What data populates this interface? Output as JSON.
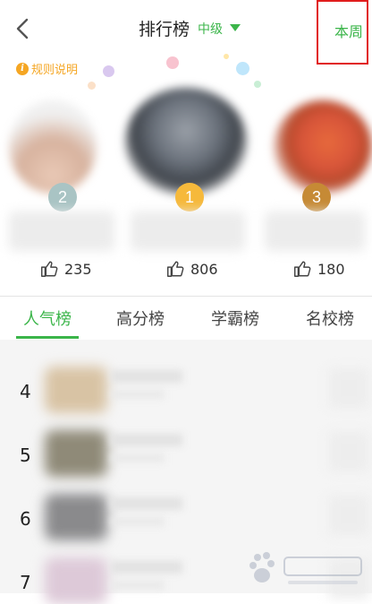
{
  "header": {
    "title": "排行榜",
    "level_label": "中级",
    "week_label": "本周",
    "back_icon": "chevron-left-icon"
  },
  "rules": {
    "icon": "info-icon",
    "icon_glyph": "i",
    "label": "规则说明"
  },
  "podium": [
    {
      "rank": "2",
      "likes": "235",
      "badge_color": "#a9c4c4"
    },
    {
      "rank": "1",
      "likes": "806",
      "badge_color": "#f6b93b"
    },
    {
      "rank": "3",
      "likes": "180",
      "badge_color": "#c68a35"
    }
  ],
  "tabs": [
    {
      "label": "人气榜",
      "active": true
    },
    {
      "label": "高分榜",
      "active": false
    },
    {
      "label": "学霸榜",
      "active": false
    },
    {
      "label": "名校榜",
      "active": false
    }
  ],
  "list": [
    {
      "rank": "4"
    },
    {
      "rank": "5"
    },
    {
      "rank": "6"
    },
    {
      "rank": "7"
    }
  ],
  "colors": {
    "accent": "#3bb54a",
    "highlight_box": "#e11d1d",
    "rules": "#f5a623"
  }
}
